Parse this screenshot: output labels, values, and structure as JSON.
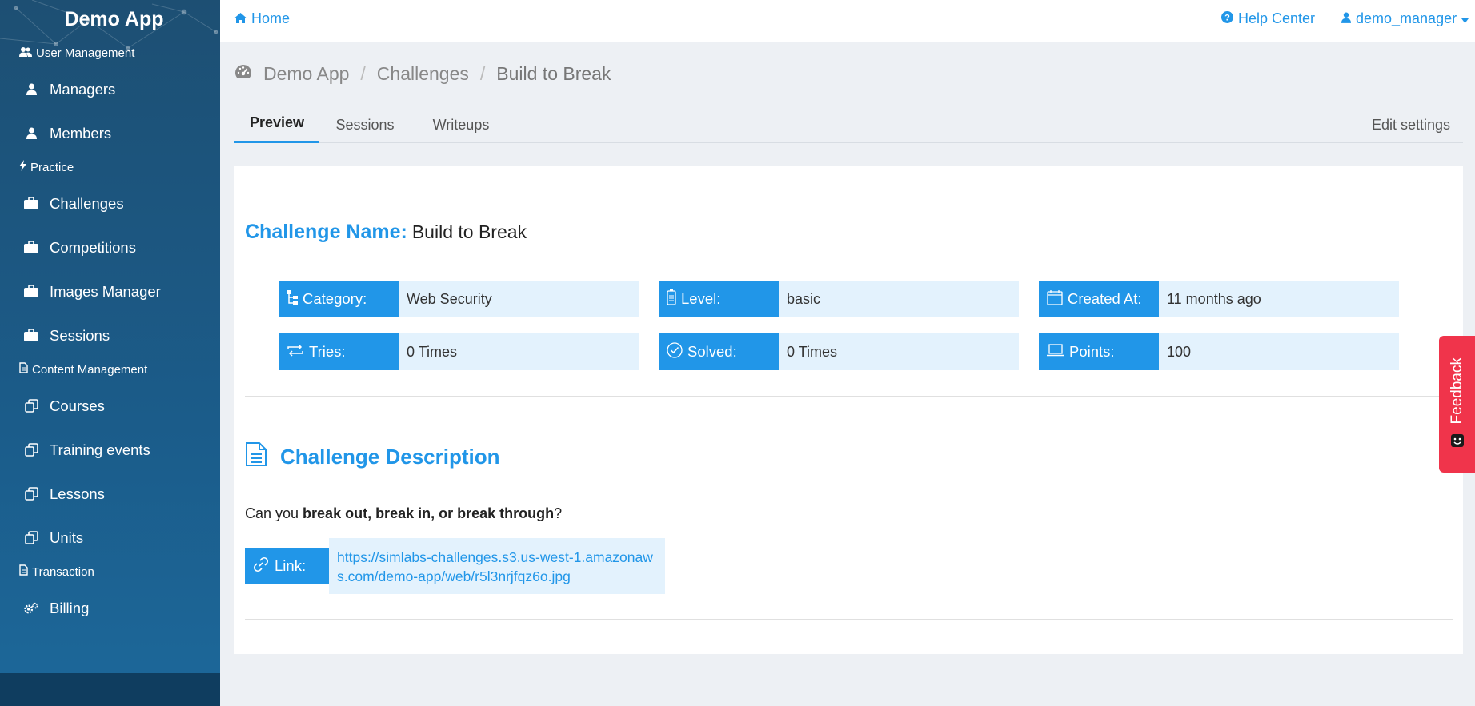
{
  "sidebar": {
    "brand": "Demo App",
    "sections": [
      {
        "title": "User Management",
        "items": [
          "Managers",
          "Members"
        ]
      },
      {
        "title": "Practice",
        "items": [
          "Challenges",
          "Competitions",
          "Images Manager",
          "Sessions"
        ]
      },
      {
        "title": "Content Management",
        "items": [
          "Courses",
          "Training events",
          "Lessons",
          "Units"
        ]
      },
      {
        "title": "Transaction",
        "items": [
          "Billing"
        ]
      }
    ]
  },
  "topbar": {
    "home": "Home",
    "help": "Help Center",
    "user": "demo_manager"
  },
  "breadcrumb": [
    "Demo App",
    "Challenges",
    "Build to Break"
  ],
  "tabs": [
    "Preview",
    "Sessions",
    "Writeups"
  ],
  "edit_settings": "Edit settings",
  "challenge": {
    "name_label": "Challenge Name:",
    "name": "Build to Break",
    "info": [
      {
        "label": "Category:",
        "value": "Web Security"
      },
      {
        "label": "Level:",
        "value": "basic"
      },
      {
        "label": "Created At:",
        "value": "11 months ago"
      },
      {
        "label": "Tries:",
        "value": "0 Times"
      },
      {
        "label": "Solved:",
        "value": "0 Times"
      },
      {
        "label": "Points:",
        "value": "100"
      }
    ],
    "desc_heading": "Challenge Description",
    "desc_prefix": "Can you ",
    "desc_bold": "break out, break in, or break through",
    "desc_suffix": "?",
    "link_label": "Link:",
    "link_url": "https://simlabs-challenges.s3.us-west-1.amazonaws.com/demo-app/web/r5l3nrjfqz6o.jpg"
  },
  "feedback": "Feedback",
  "colors": {
    "accent": "#2196e8",
    "feedback": "#f0344b",
    "sidebar": "#1b5c8a"
  }
}
